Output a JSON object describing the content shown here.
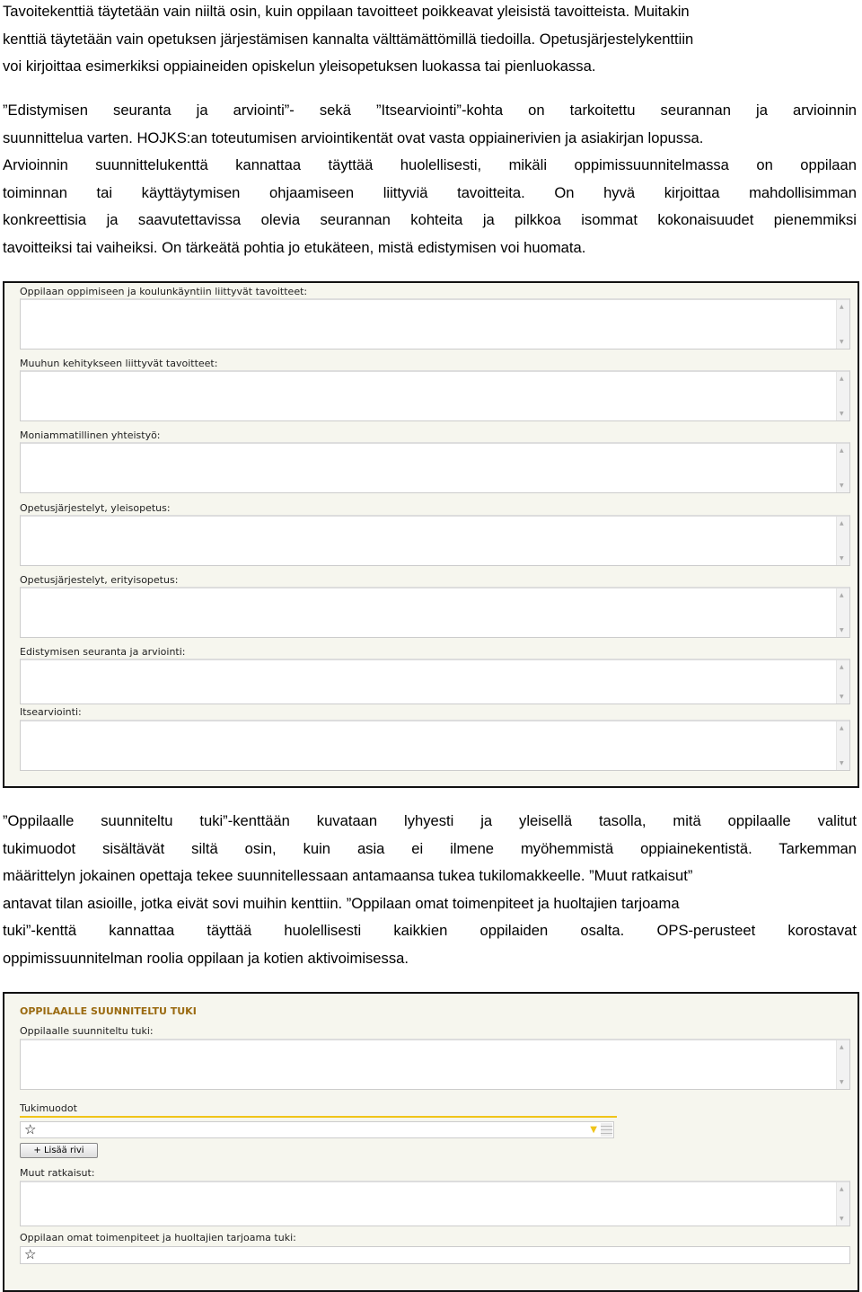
{
  "paragraphs": {
    "p1": [
      "Tavoitekenttiä täytetään vain niiltä osin, kuin oppilaan tavoitteet poikkeavat yleisistä tavoitteista. Muitakin",
      "kenttiä täytetään vain opetuksen järjestämisen kannalta välttämättömillä tiedoilla. Opetusjärjestelykenttiin",
      "voi kirjoittaa esimerkiksi oppiaineiden opiskelun yleisopetuksen luokassa tai pienluokassa."
    ],
    "p2": [
      "”Edistymisen seuranta ja arviointi”- sekä ”Itsearviointi”-kohta on tarkoitettu seurannan ja arvioinnin",
      "suunnittelua varten. HOJKS:an toteutumisen arviointikentät ovat vasta oppiainerivien ja asiakirjan lopussa.",
      "Arvioinnin suunnittelukenttä kannattaa täyttää huolellisesti, mikäli oppimissuunnitelmassa on oppilaan",
      "toiminnan tai käyttäytymisen ohjaamiseen liittyviä tavoitteita. On hyvä kirjoittaa mahdollisimman",
      "konkreettisia ja saavutettavissa olevia seurannan kohteita ja pilkkoa isommat kokonaisuudet pienemmiksi",
      "tavoitteiksi tai vaiheiksi. On tärkeätä pohtia jo etukäteen, mistä edistymisen voi huomata."
    ],
    "p3": [
      "”Oppilaalle suunniteltu tuki”-kenttään kuvataan lyhyesti ja yleisellä tasolla, mitä oppilaalle valitut",
      "tukimuodot sisältävät siltä osin, kuin asia ei ilmene myöhemmistä oppiainekentistä. Tarkemman",
      "määrittelyn jokainen opettaja tekee suunnitellessaan antamaansa tukea tukilomakkeelle. ”Muut ratkaisut”",
      "antavat tilan asioille, jotka eivät sovi muihin kenttiin. ”Oppilaan omat toimenpiteet ja huoltajien tarjoama",
      "tuki”-kenttä kannattaa täyttää huolellisesti kaikkien oppilaiden osalta. OPS-perusteet korostavat",
      "oppimissuunnitelman roolia oppilaan ja kotien aktivoimisessa."
    ]
  },
  "form1": {
    "fields": [
      "Oppilaan oppimiseen ja koulunkäyntiin liittyvät tavoitteet:",
      "Muuhun kehitykseen liittyvät tavoitteet:",
      "Moniammatillinen yhteistyö:",
      "Opetusjärjestelyt, yleisopetus:",
      "Opetusjärjestelyt, erityisopetus:",
      "Edistymisen seuranta ja arviointi:",
      "Itsearviointi:"
    ]
  },
  "form2": {
    "heading": "OPPILAALLE SUUNNITELTU TUKI",
    "support_label": "Oppilaalle suunniteltu tuki:",
    "forms_label": "Tukimuodot",
    "add_row": "+ Lisää rivi",
    "other_label": "Muut ratkaisut:",
    "own_label": "Oppilaan omat toimenpiteet ja huoltajien tarjoama tuki:",
    "star": "☆"
  },
  "colors": {
    "heading": "#9a6a10",
    "underline": "#f0c419",
    "form_bg": "#f6f6ee"
  }
}
